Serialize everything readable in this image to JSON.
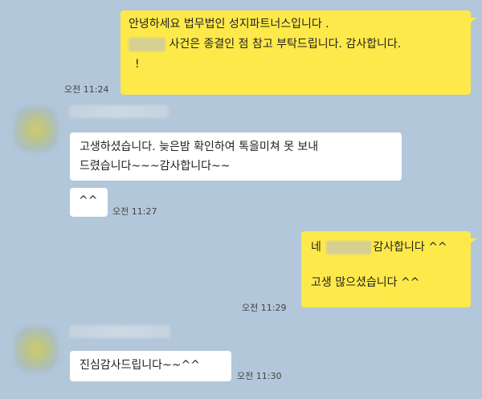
{
  "messages": [
    {
      "lines": [
        "안녕하세요 법무법인 성지파트너스입니다 .",
        "사건은 종결인 점 참고 부탁드립니다. 감사합니다.",
        "!"
      ],
      "time": "오전 11:24"
    },
    {
      "lines": [
        "고생하셨습니다.  늦은밤 확인하여  톡을미쳐  못 보내",
        "드렸습니다~~~감사합니다~~"
      ]
    },
    {
      "text": "^^",
      "time": "오전 11:27"
    },
    {
      "line1_prefix": "네",
      "line1_suffix": "감사합니다 ^^",
      "line2": "고생 많으셨습니다 ^^",
      "time": "오전 11:29"
    },
    {
      "text": "진심감사드립니다~~^^",
      "time": "오전 11:30"
    }
  ]
}
